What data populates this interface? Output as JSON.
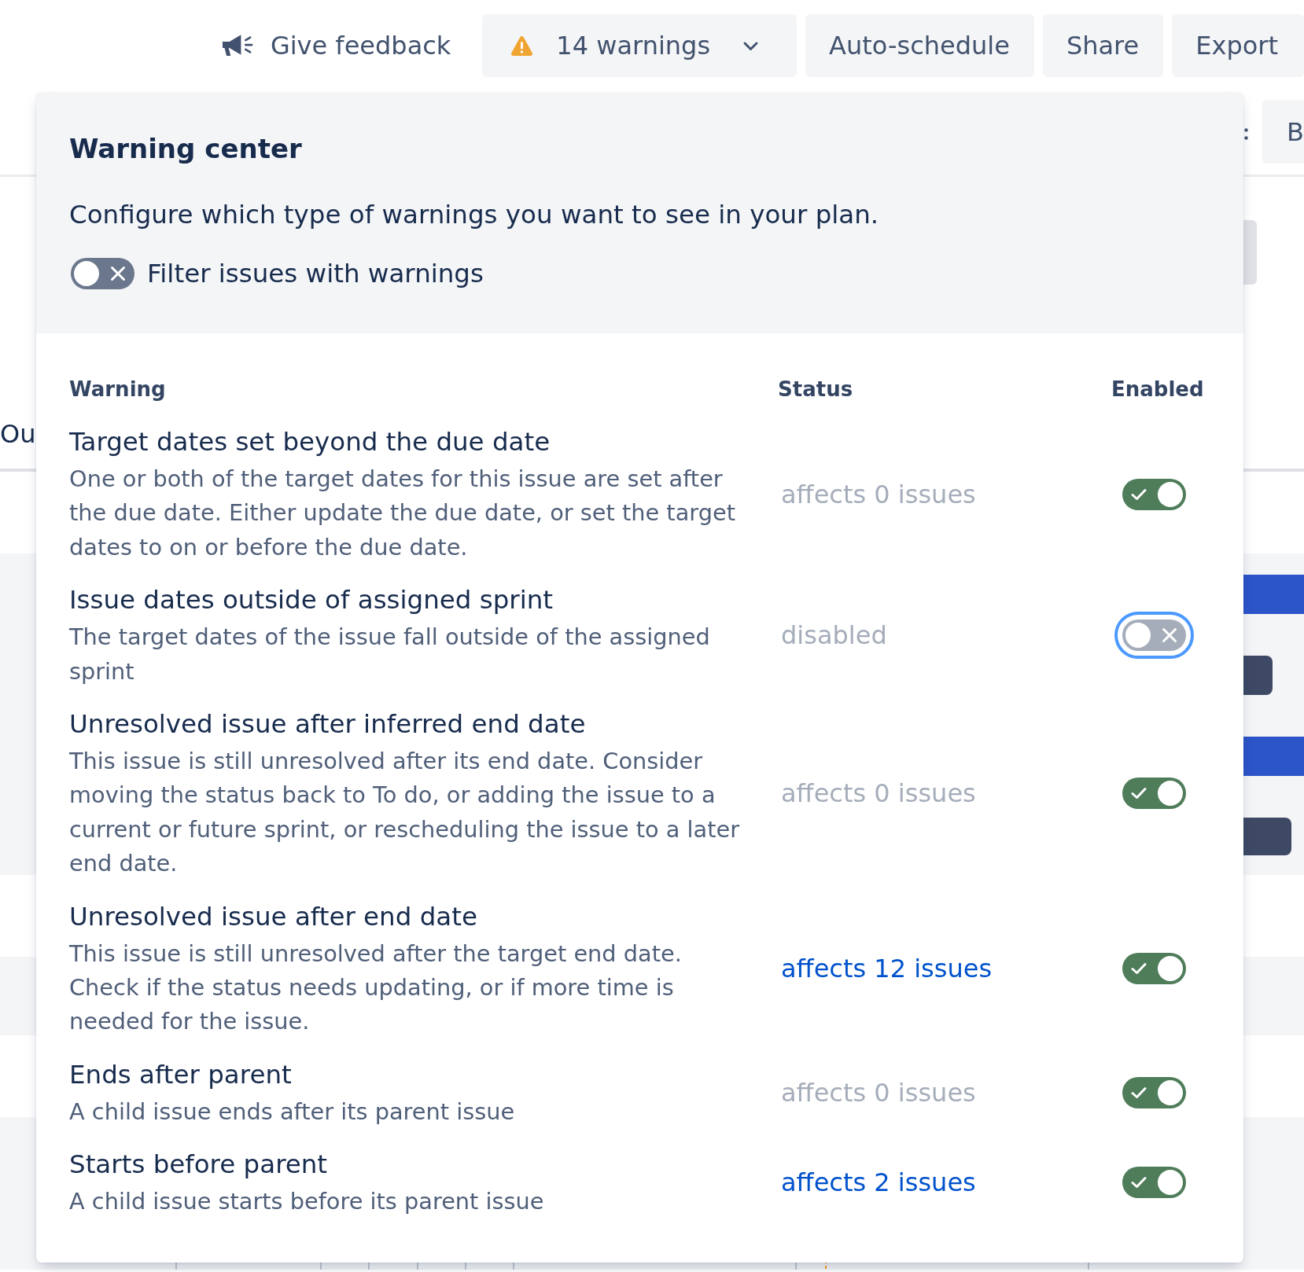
{
  "top_bar": {
    "feedback_button": {
      "label": "Give feedback"
    },
    "warnings_button": {
      "label": "14 warnings"
    },
    "buttons": [
      {
        "label": "Auto-schedule"
      },
      {
        "label": "Share"
      },
      {
        "label": "Export"
      }
    ]
  },
  "background": {
    "toolbar_button": {
      "label": "B"
    },
    "tab_label": "Ou"
  },
  "warning_center": {
    "title": "Warning center",
    "description": "Configure which type of warnings you want to see in your plan.",
    "filter_toggle": {
      "label": "Filter issues with warnings",
      "on": false
    },
    "columns": [
      "Warning",
      "Status",
      "Enabled"
    ],
    "rows": [
      {
        "title": "Target dates set beyond the due date",
        "description": "One or both of the target dates for this issue are set after the due date. Either update the due date, or set the target dates to on or before the due date.",
        "status": {
          "text": "affects 0 issues",
          "kind": "plain"
        },
        "enabled": true,
        "focused": false
      },
      {
        "title": "Issue dates outside of assigned sprint",
        "description": "The target dates of the issue fall outside of the assigned sprint",
        "status": {
          "text": "disabled",
          "kind": "plain"
        },
        "enabled": false,
        "focused": true
      },
      {
        "title": "Unresolved issue after inferred end date",
        "description": "This issue is still unresolved after its end date. Consider moving the status back to To do, or adding the issue to a current or future sprint, or rescheduling the issue to a later end date.",
        "status": {
          "text": "affects 0 issues",
          "kind": "plain"
        },
        "enabled": true,
        "focused": false
      },
      {
        "title": "Unresolved issue after end date",
        "description": "This issue is still unresolved after the target end date. Check if the status needs updating, or if more time is needed for the issue.",
        "status": {
          "text": "affects 12 issues",
          "kind": "link"
        },
        "enabled": true,
        "focused": false
      },
      {
        "title": "Ends after parent",
        "description": "A child issue ends after its parent issue",
        "status": {
          "text": "affects 0 issues",
          "kind": "plain"
        },
        "enabled": true,
        "focused": false
      },
      {
        "title": "Starts before parent",
        "description": "A child issue starts before its parent issue",
        "status": {
          "text": "affects 2 issues",
          "kind": "link"
        },
        "enabled": true,
        "focused": false
      }
    ]
  }
}
